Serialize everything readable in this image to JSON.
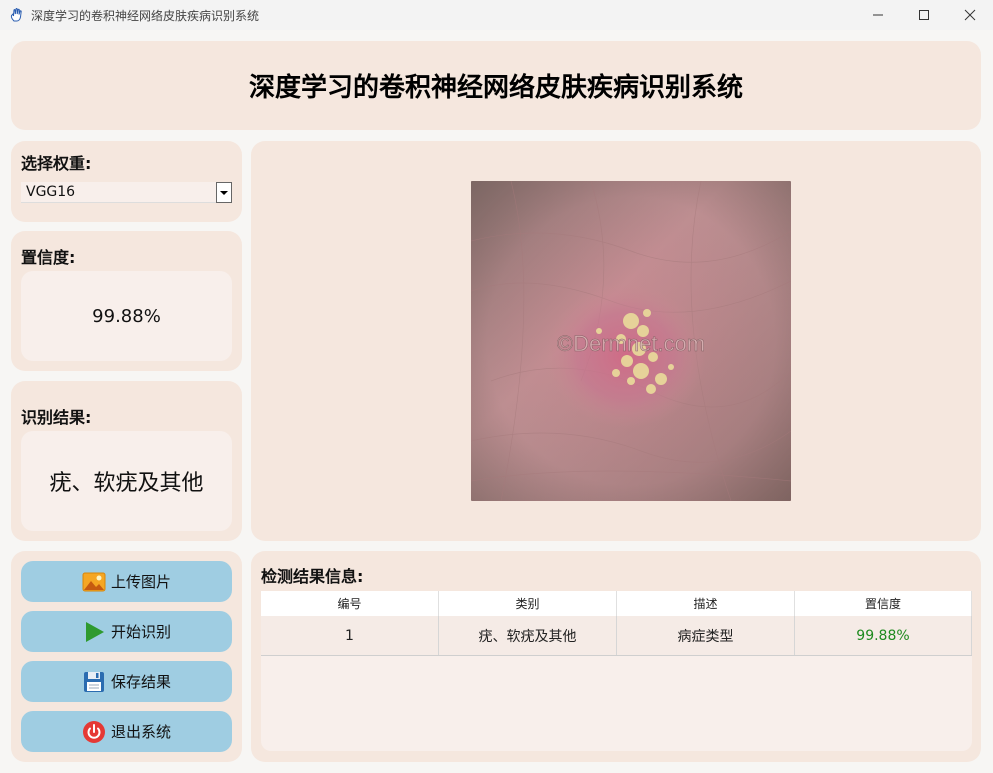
{
  "window": {
    "title": "深度学习的卷积神经网络皮肤疾病识别系统"
  },
  "header": {
    "title": "深度学习的卷积神经网络皮肤疾病识别系统"
  },
  "weights": {
    "label": "选择权重:",
    "selected": "VGG16"
  },
  "confidence": {
    "label": "置信度:",
    "value": "99.88%"
  },
  "result": {
    "label": "识别结果:",
    "value": "疣、软疣及其他"
  },
  "image": {
    "watermark": "©Dermnet.com"
  },
  "buttons": {
    "upload": "上传图片",
    "start": "开始识别",
    "save": "保存结果",
    "exit": "退出系统"
  },
  "table": {
    "label": "检测结果信息:",
    "headers": [
      "编号",
      "类别",
      "描述",
      "置信度"
    ],
    "rows": [
      [
        "1",
        "疣、软疣及其他",
        "病症类型",
        "99.88%"
      ]
    ]
  },
  "icons": {
    "app": "hand-icon",
    "upload": "image-icon",
    "start": "play-icon",
    "save": "floppy-disk-icon",
    "exit": "power-icon"
  },
  "colors": {
    "panel": "#f5e7de",
    "button": "#9fcde2",
    "confidence_text": "#1e8a1e"
  }
}
